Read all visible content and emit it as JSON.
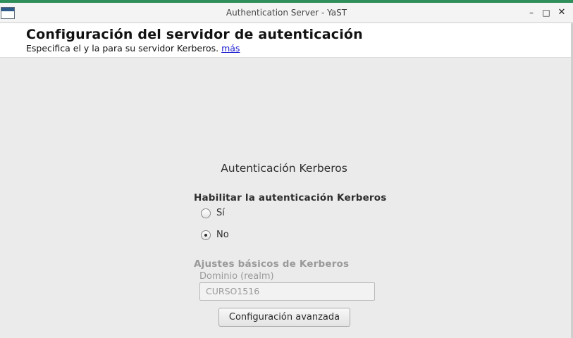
{
  "window": {
    "title": "Authentication Server - YaST",
    "min_glyph": "–",
    "max_glyph": "□",
    "close_glyph": "✕"
  },
  "header": {
    "title": "Configuración del servidor de autenticación",
    "subtitle": "Especifica el y la para su servidor Kerberos.",
    "help_link": "más"
  },
  "kerberos": {
    "section_title": "Autenticación Kerberos",
    "enable_label": "Habilitar la autenticación Kerberos",
    "options": [
      {
        "label": "Sí",
        "selected": false
      },
      {
        "label": "No",
        "selected": true
      }
    ]
  },
  "basic_settings": {
    "title": "Ajustes básicos de Kerberos",
    "realm_label": "Dominio (realm)",
    "realm_value": "CURSO1516",
    "realm_enabled": false
  },
  "advanced_button": "Configuración avanzada",
  "colors": {
    "accent": "#2f8f5a",
    "link": "#1a1acc",
    "disabled_text": "#9a9a9a"
  }
}
